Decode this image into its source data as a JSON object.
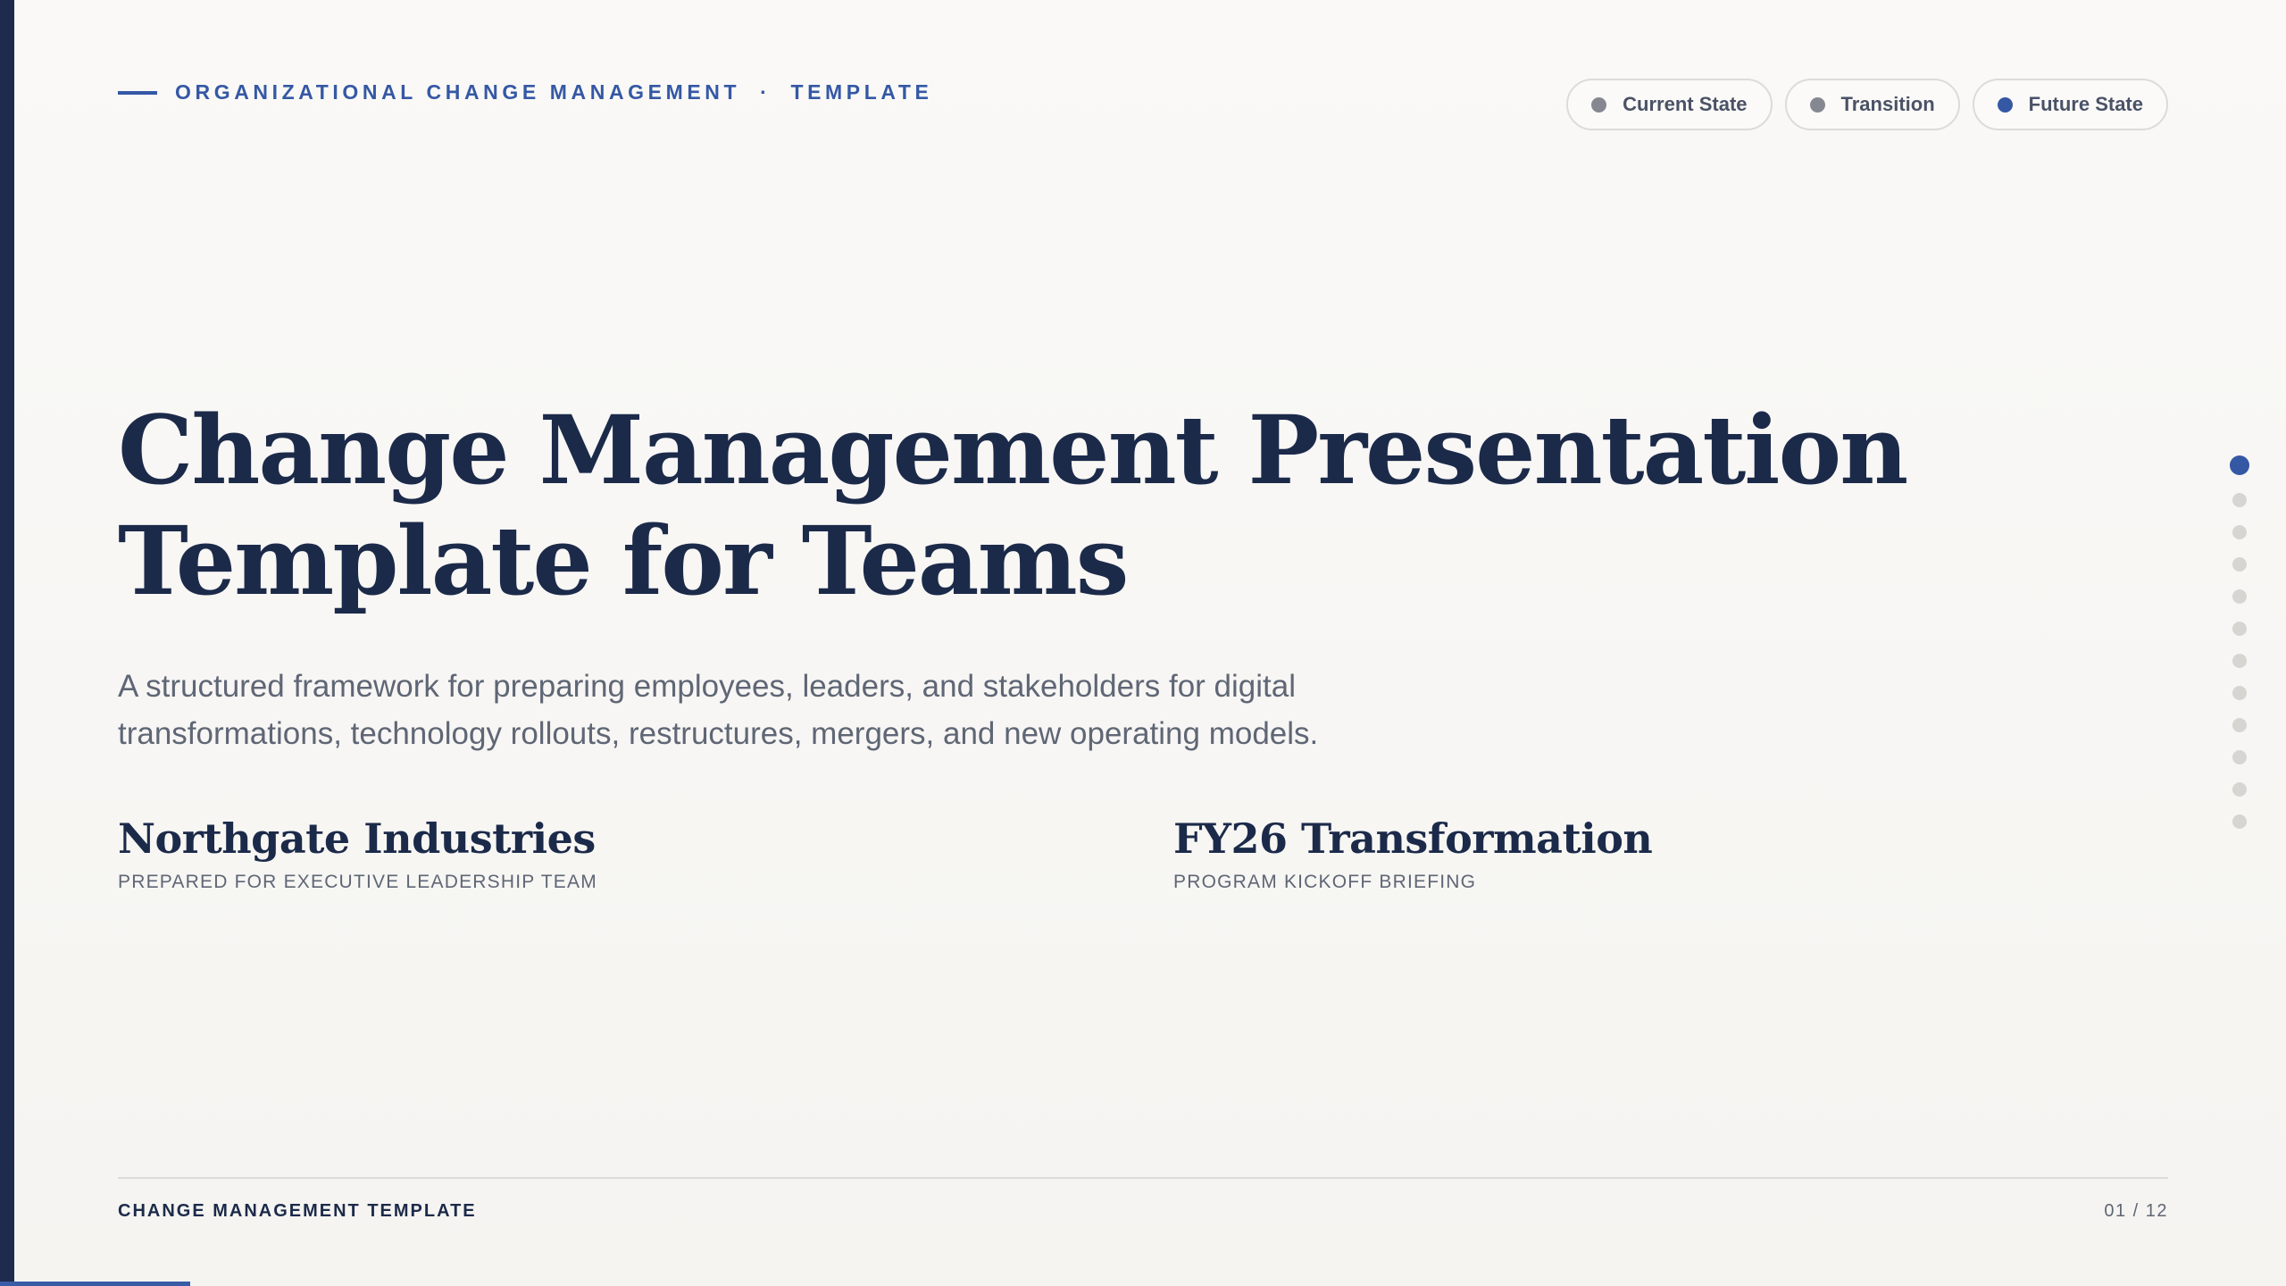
{
  "header": {
    "eyebrow_main": "ORGANIZATIONAL CHANGE MANAGEMENT",
    "eyebrow_separator": "·",
    "eyebrow_sub": "TEMPLATE"
  },
  "legend": [
    {
      "label": "Current State",
      "color": "#868891"
    },
    {
      "label": "Transition",
      "color": "#868891"
    },
    {
      "label": "Future State",
      "color": "#3558a5"
    }
  ],
  "hero": {
    "title_line1": "Change Management Presentation",
    "title_line2": "Template for Teams",
    "subtitle": "A structured framework for preparing employees, leaders, and stakeholders for digital transformations, technology rollouts, restructures, mergers, and new operating models."
  },
  "meta": {
    "client_name": "Northgate Industries",
    "client_caption": "PREPARED FOR EXECUTIVE LEADERSHIP TEAM",
    "program_name": "FY26 Transformation",
    "program_caption": "PROGRAM KICKOFF BRIEFING"
  },
  "navigation": {
    "total_slides": 12,
    "current_slide": 1
  },
  "footer": {
    "left_label": "CHANGE MANAGEMENT TEMPLATE",
    "page_indicator": "01 / 12"
  },
  "colors": {
    "accent": "#3558a5",
    "navy": "#1c2a4a",
    "muted": "#5f6675",
    "background": "#faf9f7"
  }
}
